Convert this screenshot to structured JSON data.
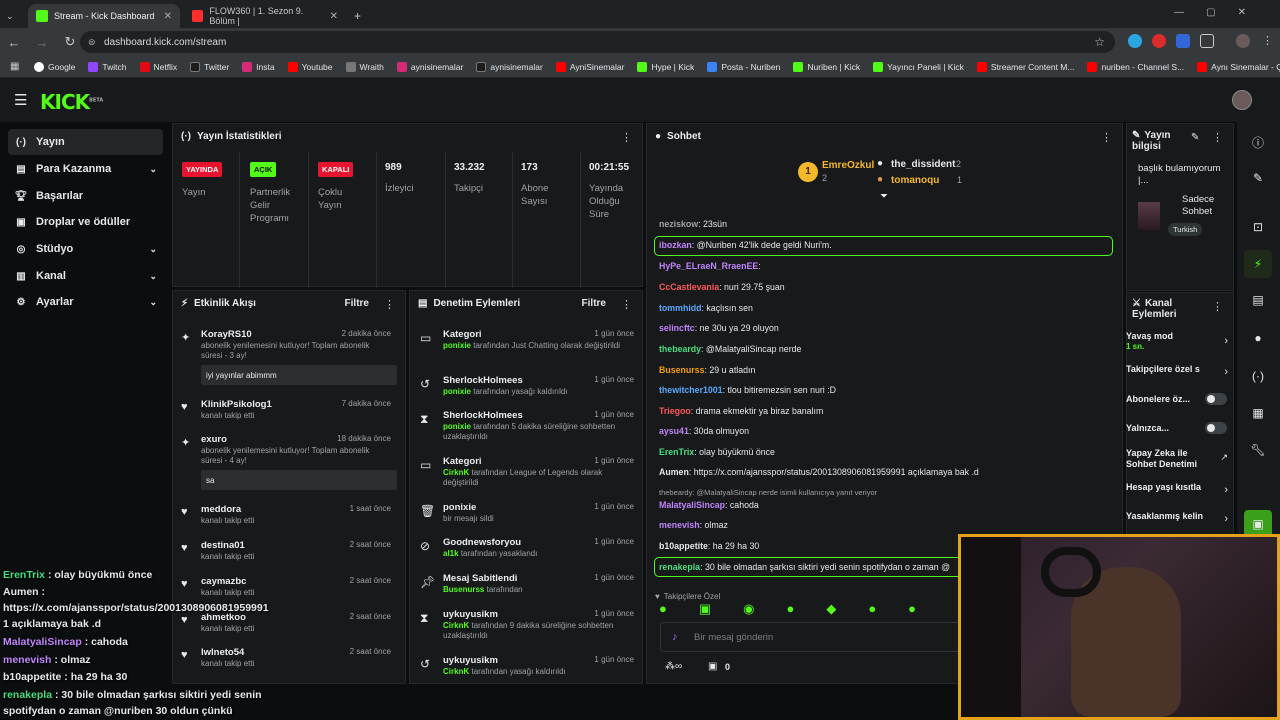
{
  "browser": {
    "tabs": [
      {
        "title": "Stream - Kick Dashboard",
        "active": true
      },
      {
        "title": "FLOW360 | 1. Sezon 9. Bölüm | ",
        "active": false
      }
    ],
    "new_tab": "+",
    "url": "dashboard.kick.com/stream",
    "bookmarks": [
      "Google",
      "Twitch",
      "Netflix",
      "Twitter",
      "Insta",
      "Youtube",
      "Wraith",
      "aynisinemalar",
      "aynisinemalar",
      "AyniSinemalar",
      "Hype | Kick",
      "Posta - Nuriben",
      "Nuriben | Kick",
      "Yayıncı Paneli | Kick",
      "Streamer Content M...",
      "nuriben - Channel S...",
      "Aynı Sinemalar - Ça..."
    ]
  },
  "kick": {
    "logo": "KICK",
    "beta": "BETA"
  },
  "sidebar": {
    "items": [
      {
        "label": "Yayın",
        "active": true
      },
      {
        "label": "Para Kazanma"
      },
      {
        "label": "Başarılar"
      },
      {
        "label": "Droplar ve ödüller"
      },
      {
        "label": "Stüdyo"
      },
      {
        "label": "Kanal"
      },
      {
        "label": "Ayarlar"
      }
    ]
  },
  "stats": {
    "title": "Yayın İstatistikleri",
    "badges": [
      {
        "badge": "YAYINDA",
        "label": "Yayın",
        "color": "#e8142f"
      },
      {
        "badge": "AÇIK",
        "label": "Partnerlik Gelir Programı",
        "color": "#53fc18"
      },
      {
        "badge": "KAPALI",
        "label": "Çoklu Yayın",
        "color": "#e8142f"
      }
    ],
    "values": [
      {
        "value": "989",
        "label": "İzleyici"
      },
      {
        "value": "33.232",
        "label": "Takipçi"
      },
      {
        "value": "173",
        "label": "Abone Sayısı"
      },
      {
        "value": "00:21:55",
        "label": "Yayında Olduğu Süre"
      }
    ]
  },
  "activity": {
    "title": "Etkinlik Akışı",
    "filter": "Filtre",
    "events": [
      {
        "name": "KorayRS10",
        "time": "2 dakika önce",
        "desc": "abonelik yenilemesini kutluyor! Toplam abonelik süresi - 3 ay!",
        "msg": "iyi yayınlar abimmm"
      },
      {
        "name": "KlinikPsikolog1",
        "time": "7 dakika önce",
        "desc": "kanalı takip etti"
      },
      {
        "name": "exuro",
        "time": "18 dakika önce",
        "desc": "abonelik yenilemesini kutluyor! Toplam abonelik süresi - 4 ay!",
        "msg": "sa"
      },
      {
        "name": "meddora",
        "time": "1 saat önce",
        "desc": "kanalı takip etti"
      },
      {
        "name": "destina01",
        "time": "2 saat önce",
        "desc": "kanalı takip etti"
      },
      {
        "name": "caymazbc",
        "time": "2 saat önce",
        "desc": "kanalı takip etti"
      },
      {
        "name": "ahmetkoo",
        "time": "2 saat önce",
        "desc": "kanalı takip etti"
      },
      {
        "name": "lwlneto54",
        "time": "2 saat önce",
        "desc": "kanalı takip etti"
      }
    ]
  },
  "moderation": {
    "title": "Denetim Eylemleri",
    "filter": "Filtre",
    "items": [
      {
        "name": "Kategori",
        "time": "1 gün önce",
        "user": "ponixie",
        "desc": "tarafından Just Chatting olarak değiştirildi"
      },
      {
        "name": "SherlockHolmees",
        "time": "1 gün önce",
        "user": "ponixie",
        "desc": "tarafından yasağı kaldırıldı"
      },
      {
        "name": "SherlockHolmees",
        "time": "1 gün önce",
        "user": "ponixie",
        "desc": "tarafından 5 dakika süreliğine sohbetten uzaklaştırıldı"
      },
      {
        "name": "Kategori",
        "time": "1 gün önce",
        "user": "CirknK",
        "desc": "tarafından League of Legends olarak değiştirildi"
      },
      {
        "name": "ponixie",
        "time": "1 gün önce",
        "user": "",
        "desc": "bir mesajı sildi"
      },
      {
        "name": "Goodnewsforyou",
        "time": "1 gün önce",
        "user": "al1k",
        "desc": "tarafından yasaklandı"
      },
      {
        "name": "Mesaj Sabitlendi",
        "time": "1 gün önce",
        "user": "Busenurss",
        "desc": "tarafından"
      },
      {
        "name": "uykuyusikm",
        "time": "1 gün önce",
        "user": "CirknK",
        "desc": "tarafından 9 dakika süreliğine sohbetten uzaklaştırıldı"
      },
      {
        "name": "uykuyusikm",
        "time": "1 gün önce",
        "user": "CirknK",
        "desc": "tarafından yasağı kaldırıldı"
      }
    ]
  },
  "chat": {
    "title": "Sohbet",
    "leaders": [
      {
        "name": "EmreOzkul",
        "count": "2"
      },
      {
        "name": "the_dissident",
        "count": "2"
      },
      {
        "name": "tomanoqu",
        "count": "1"
      }
    ],
    "messages": [
      {
        "user": "neziskow",
        "text": ": 23sün",
        "color": "#9ea4a8"
      },
      {
        "user": "ibozkan",
        "text": ": @Nuriben 42'lik dede geldi Nuri'm.",
        "color": "#c084fc"
      },
      {
        "user": "HyPe_ELraeN_RraenEE",
        "text": ":",
        "color": "#c084fc"
      },
      {
        "user": "CcCastlevania",
        "text": ": nuri 29.75 şuan",
        "color": "#ff5a5a"
      },
      {
        "user": "tommhidd",
        "text": ": kaçlısın sen",
        "color": "#5aa9ff"
      },
      {
        "user": "selincftc",
        "text": ": ne 30u ya 29 oluyon",
        "color": "#c084fc"
      },
      {
        "user": "thebeardy",
        "text": ": @MalatyaliSincap nerde",
        "color": "#4ade80"
      },
      {
        "user": "Busenurss",
        "text": ": 29 u atladın",
        "color": "#f59e0b"
      },
      {
        "user": "thewitcher1001",
        "text": ": tlou bitiremezsin sen nuri :D",
        "color": "#5aa9ff"
      },
      {
        "user": "Triegoo",
        "text": ": drama ekmektir ya biraz banalım",
        "color": "#ff5a5a"
      },
      {
        "user": "aysu41",
        "text": ": 30da olmuyon",
        "color": "#c084fc"
      },
      {
        "user": "ErenTrix",
        "text": ": olay büyükmü önce",
        "color": "#4ade80"
      },
      {
        "user": "Aumen",
        "text": ": https://x.com/ajansspor/status/2001308906081959991 açıklamaya bak .d",
        "color": "#e6e8ea"
      },
      {
        "user": "",
        "text": "thebeardy: @MalatyaliSincap nerde isimli kullanıcıya yanıt veriyor",
        "color": "#9ea4a8"
      },
      {
        "user": "MalatyaliSincap",
        "text": ": cahoda",
        "color": "#c084fc"
      },
      {
        "user": "menevish",
        "text": ": olmaz",
        "color": "#c084fc"
      },
      {
        "user": "b10appetite",
        "text": ": ha 29 ha 30",
        "color": "#e6e8ea"
      },
      {
        "user": "renakepla",
        "text": ": 30 bile olmadan şarkısı siktiri yedi senin spotifydan o zaman @",
        "color": "#4ade80"
      }
    ],
    "followers_only": "Takipçilere Özel",
    "input_placeholder": "Bir mesaj gönderin",
    "footer": {
      "points": "∞",
      "count": "0"
    }
  },
  "stream_info": {
    "title": "Yayın bilgisi",
    "stream_title": "başlık bulamıyorum |...",
    "category": "Sadece Sohbet",
    "tag": "Turkish"
  },
  "channel_actions": {
    "title": "Kanal Eylemleri",
    "items": [
      {
        "name": "Yavaş mod",
        "sub": "1 sn."
      },
      {
        "name": "Takipçilere özel s"
      },
      {
        "name": "Abonelere öz..."
      },
      {
        "name": "Yalnızca..."
      },
      {
        "name": "Yapay Zeka ile Sohbet Denetimi"
      },
      {
        "name": "Hesap yaşı kısıtla"
      },
      {
        "name": "Yasaklanmış kelin"
      }
    ]
  },
  "overlay": {
    "lines": [
      {
        "user": "ErenTrix",
        "text": " : olay büyükmü önce",
        "color": "#4ade80"
      },
      {
        "user": "Aumen",
        "text": " :",
        "color": "#e6e8ea"
      },
      {
        "user": "",
        "text": "https://x.com/ajansspor/status/2001308906081959991",
        "color": "#e6e8ea"
      },
      {
        "user": "",
        "text": "1 açıklamaya bak .d",
        "color": "#e6e8ea"
      },
      {
        "user": "MalatyaliSincap",
        "text": " : cahoda",
        "color": "#c084fc"
      },
      {
        "user": "menevish",
        "text": " : olmaz",
        "color": "#c084fc"
      },
      {
        "user": "b10appetite",
        "text": " : ha 29 ha 30",
        "color": "#e6e8ea"
      },
      {
        "user": "renakepla",
        "text": " : 30 bile olmadan şarkısı siktiri yedi senin",
        "color": "#4ade80"
      },
      {
        "user": "",
        "text": "spotifydan o zaman @nuriben 30 oldun çünkü",
        "color": "#e6e8ea"
      }
    ]
  }
}
